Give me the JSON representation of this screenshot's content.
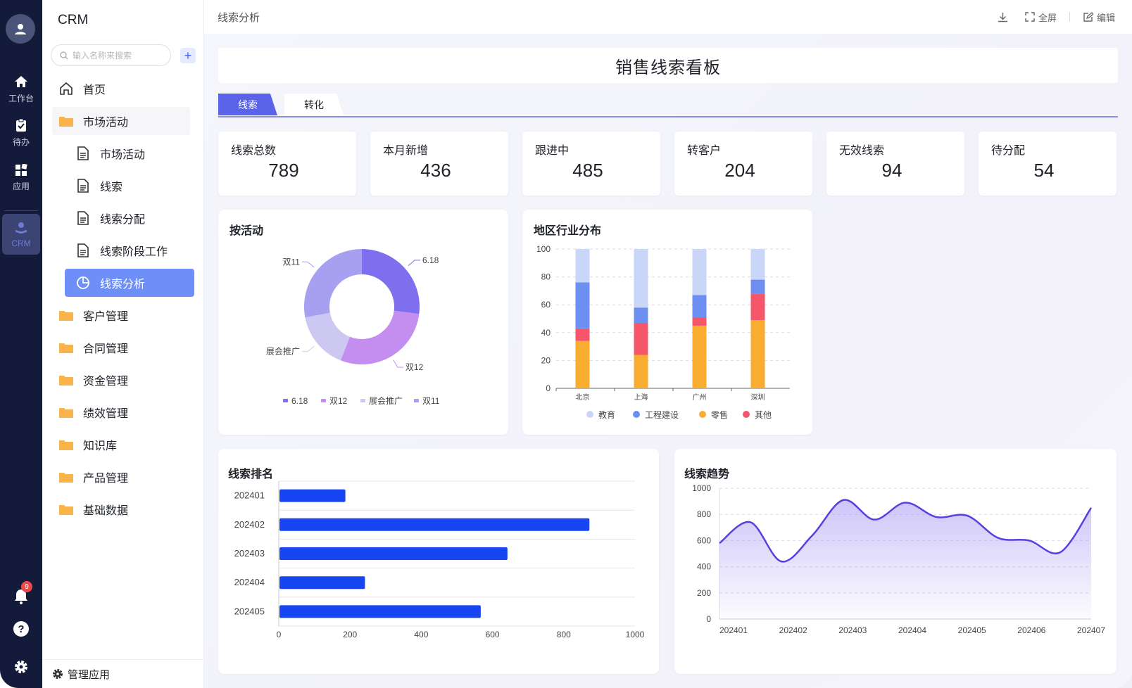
{
  "rail": {
    "items": [
      {
        "label": "工作台",
        "icon": "home-icon"
      },
      {
        "label": "待办",
        "icon": "clipboard-icon"
      },
      {
        "label": "应用",
        "icon": "apps-icon"
      },
      {
        "label": "CRM",
        "icon": "crm-icon"
      }
    ],
    "notification_count": "9"
  },
  "sidebar": {
    "brand": "CRM",
    "search_placeholder": "输入名称来搜索",
    "add_label": "+",
    "items": [
      {
        "label": "首页"
      },
      {
        "label": "市场活动"
      },
      {
        "label": "市场活动"
      },
      {
        "label": "线索"
      },
      {
        "label": "线索分配"
      },
      {
        "label": "线索阶段工作"
      },
      {
        "label": "线索分析"
      },
      {
        "label": "客户管理"
      },
      {
        "label": "合同管理"
      },
      {
        "label": "资金管理"
      },
      {
        "label": "绩效管理"
      },
      {
        "label": "知识库"
      },
      {
        "label": "产品管理"
      },
      {
        "label": "基础数据"
      }
    ],
    "manage": "管理应用"
  },
  "topbar": {
    "breadcrumb": "线索分析",
    "fullscreen": "全屏",
    "edit": "编辑"
  },
  "dashboard": {
    "title": "销售线索看板",
    "tabs": [
      "线索",
      "转化"
    ],
    "kpis": [
      {
        "label": "线索总数",
        "value": "789"
      },
      {
        "label": "本月新增",
        "value": "436"
      },
      {
        "label": "跟进中",
        "value": "485"
      },
      {
        "label": "转客户",
        "value": "204"
      },
      {
        "label": "无效线索",
        "value": "94"
      },
      {
        "label": "待分配",
        "value": "54"
      }
    ]
  },
  "colors": {
    "accent": "#5b62ea",
    "bar_blue": "#1745f2",
    "line_purple": "#5a3fe0"
  },
  "chart_data": [
    {
      "type": "pie",
      "title": "按活动",
      "categories": [
        "6.18",
        "双12",
        "展会推广",
        "双11"
      ],
      "values": [
        27,
        29,
        16,
        28
      ],
      "colors": [
        "#7f6fef",
        "#c48ef0",
        "#cdc8f2",
        "#a79ff0"
      ],
      "legend": "bottom"
    },
    {
      "type": "bar",
      "title": "地区行业分布",
      "stacked": true,
      "categories": [
        "北京",
        "上海",
        "广州",
        "深圳"
      ],
      "series": [
        {
          "name": "零售",
          "values": [
            34,
            24,
            45,
            49
          ],
          "color": "#f8ad30"
        },
        {
          "name": "其他",
          "values": [
            9,
            23,
            6,
            19
          ],
          "color": "#f5566a"
        },
        {
          "name": "工程建设",
          "values": [
            33,
            11,
            16,
            10
          ],
          "color": "#6d8ff2"
        },
        {
          "name": "教育",
          "values": [
            24,
            42,
            33,
            22
          ],
          "color": "#c9d6f7"
        }
      ],
      "legend_order": [
        "教育",
        "工程建设",
        "零售",
        "其他"
      ],
      "ylim": [
        0,
        100
      ],
      "yticks": [
        0,
        20,
        40,
        60,
        80,
        100
      ],
      "grid": true,
      "legend": "bottom"
    },
    {
      "type": "bar",
      "orientation": "horizontal",
      "title": "线索排名",
      "categories": [
        "202401",
        "202402",
        "202403",
        "202404",
        "202405"
      ],
      "values": [
        185,
        870,
        640,
        240,
        565
      ],
      "xlim": [
        0,
        1000
      ],
      "xticks": [
        0,
        200,
        400,
        600,
        800,
        1000
      ],
      "grid": true
    },
    {
      "type": "area",
      "title": "线索趋势",
      "x": [
        "202401",
        "",
        "202402",
        "",
        "202403",
        "",
        "202404",
        "",
        "202405",
        "",
        "202406",
        "",
        "202407"
      ],
      "x_labels": [
        "202401",
        "202402",
        "202403",
        "202404",
        "202405",
        "202406",
        "202407"
      ],
      "values": [
        580,
        740,
        440,
        640,
        910,
        760,
        890,
        780,
        790,
        620,
        600,
        510,
        850
      ],
      "ylim": [
        0,
        1000
      ],
      "yticks": [
        0,
        200,
        400,
        600,
        800,
        1000
      ],
      "grid": true
    }
  ]
}
